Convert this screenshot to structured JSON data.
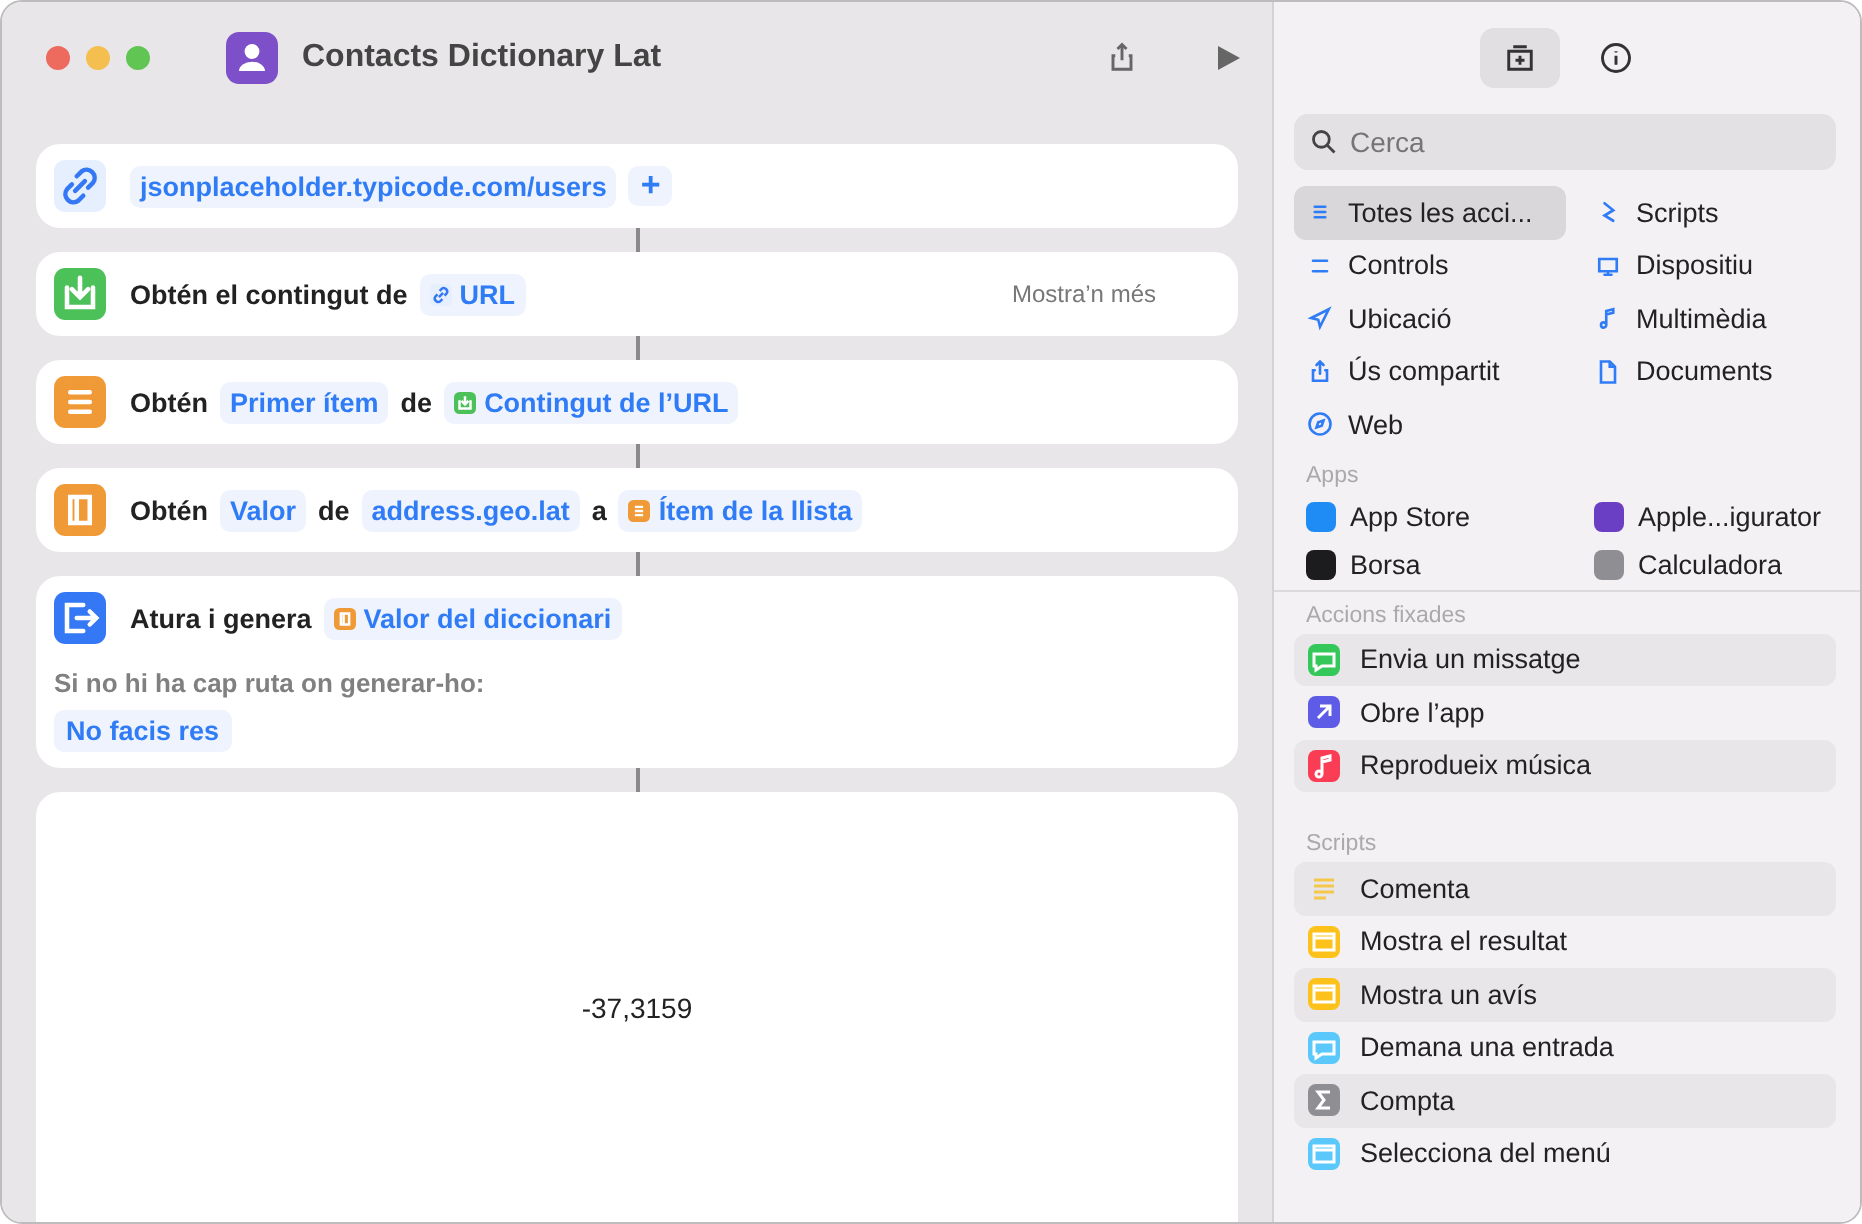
{
  "window": {
    "title": "Contacts Dictionary Lat"
  },
  "actions": [
    {
      "parts": [
        {
          "kind": "token",
          "text": "jsonplaceholder.typicode.com/users"
        },
        {
          "kind": "add",
          "text": "+"
        }
      ]
    },
    {
      "parts": [
        {
          "kind": "label",
          "text": "Obtén el contingut de"
        },
        {
          "kind": "ref",
          "text": "URL"
        }
      ],
      "more": "Mostra’n més"
    },
    {
      "parts": [
        {
          "kind": "label",
          "text": "Obtén"
        },
        {
          "kind": "token",
          "text": "Primer ítem"
        },
        {
          "kind": "label",
          "text": "de"
        },
        {
          "kind": "ref",
          "text": "Contingut de l’URL"
        }
      ]
    },
    {
      "parts": [
        {
          "kind": "label",
          "text": "Obtén"
        },
        {
          "kind": "token",
          "text": "Valor"
        },
        {
          "kind": "label",
          "text": "de"
        },
        {
          "kind": "token",
          "text": "address.geo.lat"
        },
        {
          "kind": "label",
          "text": "a"
        },
        {
          "kind": "ref",
          "text": "Ítem de la llista"
        }
      ]
    },
    {
      "parts": [
        {
          "kind": "label",
          "text": "Atura i genera"
        },
        {
          "kind": "ref",
          "text": "Valor del diccionari"
        }
      ],
      "note": "Si no hi ha cap ruta on generar-ho:",
      "option": "No facis res"
    }
  ],
  "result": "-37,3159",
  "sidebar": {
    "tabs": [
      {
        "selected": true
      },
      {
        "selected": false
      }
    ],
    "search": {
      "placeholder": "Cerca"
    },
    "categories": [
      {
        "label": "Totes les acci...",
        "selected": true
      },
      {
        "label": "Scripts",
        "selected": false
      },
      {
        "label": "Controls",
        "selected": false
      },
      {
        "label": "Dispositiu",
        "selected": false
      },
      {
        "label": "Ubicació",
        "selected": false
      },
      {
        "label": "Multimèdia",
        "selected": false
      },
      {
        "label": "Ús compartit",
        "selected": false
      },
      {
        "label": "Documents",
        "selected": false
      },
      {
        "label": "Web",
        "selected": false
      }
    ],
    "apps_heading": "Apps",
    "apps": [
      {
        "label": "App Store",
        "color": "#1f8cf5"
      },
      {
        "label": "Apple...igurator",
        "color": "#6b3fc4"
      },
      {
        "label": "Borsa",
        "color": "#1c1c1e"
      },
      {
        "label": "Calculadora",
        "color": "#8e8e93"
      }
    ],
    "pinned_heading": "Accions fixades",
    "pinned": [
      {
        "color": "#34c759",
        "label": "Envia un missatge"
      },
      {
        "color": "#5e5ce6",
        "label": "Obre l’app"
      },
      {
        "color": "#fa3c55",
        "label": "Reprodueix música"
      }
    ],
    "scripts_heading": "Scripts",
    "scripts": [
      {
        "color": "#f5c84c",
        "label": "Comenta"
      },
      {
        "color": "#fcc21b",
        "label": "Mostra el resultat"
      },
      {
        "color": "#fcc21b",
        "label": "Mostra un avís"
      },
      {
        "color": "#5ac8fa",
        "label": "Demana una entrada"
      },
      {
        "color": "#8e8e93",
        "label": "Compta"
      },
      {
        "color": "#5ac8fa",
        "label": "Selecciona del menú"
      }
    ]
  }
}
